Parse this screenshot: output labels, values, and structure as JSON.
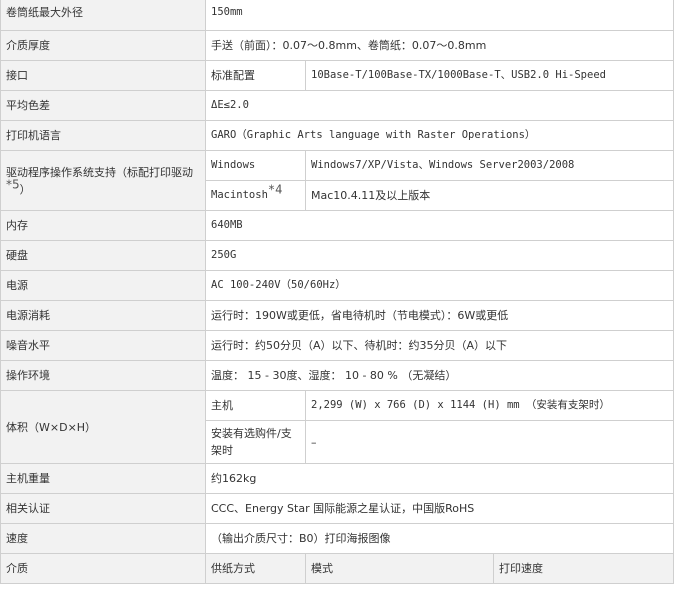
{
  "rows": {
    "outer_diameter": {
      "label": "卷筒纸最大外径",
      "value": "150mm"
    },
    "media_thickness": {
      "label": "介质厚度",
      "value": "手送（前面）：0.07～0.8mm、卷筒纸：0.07～0.8mm"
    },
    "interface": {
      "label": "接口",
      "sub": "标准配置",
      "value": "10Base-T/100Base-TX/1000Base-T、USB2.0 Hi-Speed"
    },
    "color_diff": {
      "label": "平均色差",
      "value": "ΔE≤2.0"
    },
    "printer_language": {
      "label": "打印机语言",
      "value": "GARO（Graphic Arts language with Raster Operations）"
    },
    "driver_os": {
      "label": "驱动程序操作系统支持（标配打印驱动",
      "label_note": "*5",
      "label_tail": "）",
      "windows_label": "Windows",
      "windows_value": "Windows7/XP/Vista、Windows Server2003/2008",
      "mac_label": "Macintosh",
      "mac_note": "*4",
      "mac_value": "Mac10.4.11及以上版本"
    },
    "memory": {
      "label": "内存",
      "value": "640MB"
    },
    "hdd": {
      "label": "硬盘",
      "value": "250G"
    },
    "power": {
      "label": "电源",
      "value": "AC 100-240V（50/60Hz）"
    },
    "power_consumption": {
      "label": "电源消耗",
      "value": "运行时：190W或更低，省电待机时（节电模式）：6W或更低"
    },
    "noise": {
      "label": "噪音水平",
      "value": "运行时：约50分贝（A）以下、待机时：约35分贝（A）以下"
    },
    "environment": {
      "label": "操作环境",
      "value": "温度： 15 - 30度、湿度： 10 - 80 % （无凝结）"
    },
    "dimensions": {
      "label": "体积（W×D×H）",
      "main_label": "主机",
      "main_value": "2,299 (W) x 766 (D) x 1144 (H) mm （安装有支架时）",
      "stand_label": "安装有选购件/支架时",
      "stand_value": "–"
    },
    "weight": {
      "label": "主机重量",
      "value": "约162kg"
    },
    "certification": {
      "label": "相关认证",
      "value": "CCC、Energy Star 国际能源之星认证，中国版RoHS"
    },
    "speed": {
      "label": "速度",
      "value": "（输出介质尺寸：B0）打印海报图像"
    },
    "media_header": {
      "col1": "介质",
      "col2": "供纸方式",
      "col3": "模式",
      "col4": "打印速度"
    }
  }
}
